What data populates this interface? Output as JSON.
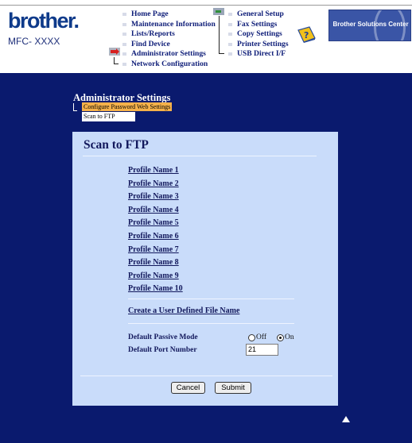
{
  "brand": {
    "logo": "brother.",
    "model": "MFC- XXXX",
    "banner": "Brother Solutions Center"
  },
  "menu": {
    "left": [
      "Home Page",
      "Maintenance Information",
      "Lists/Reports",
      "Find Device",
      "Administrator Settings",
      "Network Configuration"
    ],
    "right": [
      "General Setup",
      "Fax Settings",
      "Copy Settings",
      "Printer Settings",
      "USB Direct I/F"
    ],
    "active": "Administrator Settings"
  },
  "section": {
    "title": "Administrator Settings",
    "tabs": [
      "Configure Password",
      "Web Settings"
    ],
    "subtab": "Scan to FTP"
  },
  "panel": {
    "title": "Scan to FTP",
    "profiles": [
      "Profile Name 1",
      "Profile Name 2",
      "Profile Name 3",
      "Profile Name 4",
      "Profile Name 5",
      "Profile Name 6",
      "Profile Name 7",
      "Profile Name 8",
      "Profile Name 9",
      "Profile Name 10"
    ],
    "user_defined_link": "Create a User Defined File Name",
    "passive_mode": {
      "label": "Default Passive Mode",
      "options": [
        "Off",
        "On"
      ],
      "selected": "On"
    },
    "port": {
      "label": "Default Port Number",
      "value": "21"
    },
    "buttons": {
      "cancel": "Cancel",
      "submit": "Submit"
    }
  },
  "colors": {
    "navy": "#0a1a6e",
    "panel": "#c9dcfa",
    "tab": "#f5b14a",
    "link": "#12185c",
    "brand": "#0e3a8a"
  },
  "icons": {
    "help": "question-book-icon",
    "back_to_top": "up-arrow-icon"
  }
}
